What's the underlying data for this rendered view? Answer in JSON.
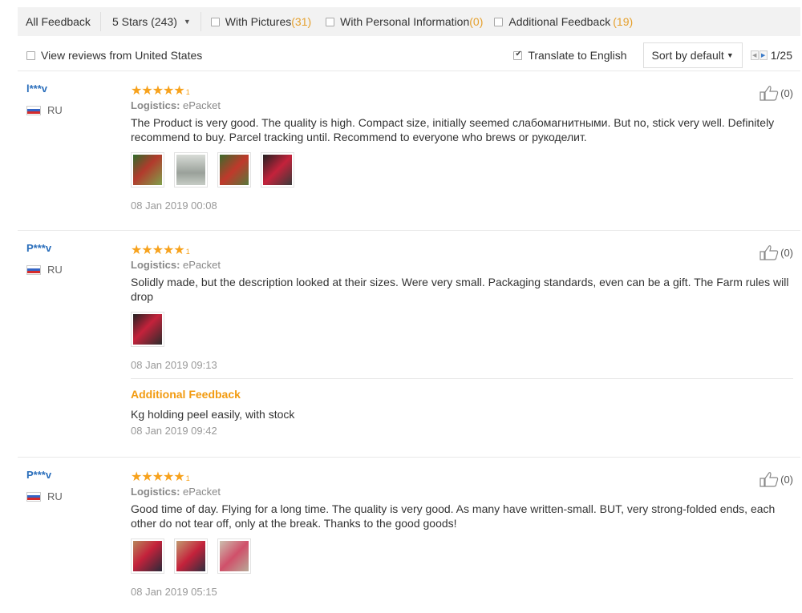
{
  "filters": {
    "all_feedback": "All Feedback",
    "stars_select": "5 Stars (243)",
    "with_pictures_label": "With Pictures",
    "with_pictures_count": "(31)",
    "personal_info_label": "With Personal Information",
    "personal_info_count": "(0)",
    "additional_label": "Additional Feedback",
    "additional_count": "(19)"
  },
  "options": {
    "view_us": "View reviews from United States",
    "translate": "Translate to English",
    "translate_checked": true,
    "sort": "Sort by default",
    "page": "1/25"
  },
  "colors": {
    "accent_orange": "#f7a21d",
    "link_blue": "#2a6ebb",
    "count_orange": "#e5a02d"
  },
  "reviews": [
    {
      "user": "l***v",
      "country": "RU",
      "rating": 5,
      "logistics_label": "Logistics:",
      "logistics_value": "ePacket",
      "text": "The Product is very good. The quality is high. Compact size, initially seemed слабомагнитными. But no, stick very well. Definitely recommend to buy. Parcel tracking until. Recommend to everyone who brews or рукоделит.",
      "images": 4,
      "date": "08 Jan 2019 00:08",
      "helpful": "(0)"
    },
    {
      "user": "P***v",
      "country": "RU",
      "rating": 5,
      "logistics_label": "Logistics:",
      "logistics_value": "ePacket",
      "text": "Solidly made, but the description looked at their sizes. Were very small. Packaging standards, even can be a gift. The Farm rules will drop",
      "images": 1,
      "date": "08 Jan 2019 09:13",
      "helpful": "(0)",
      "additional": {
        "title": "Additional Feedback",
        "text": "Kg holding peel easily, with stock",
        "date": "08 Jan 2019 09:42"
      }
    },
    {
      "user": "P***v",
      "country": "RU",
      "rating": 5,
      "logistics_label": "Logistics:",
      "logistics_value": "ePacket",
      "text": "Good time of day. Flying for a long time. The quality is very good. As many have written-small. BUT, very strong-folded ends, each other do not tear off, only at the break. Thanks to the good goods!",
      "images": 3,
      "date": "08 Jan 2019 05:15",
      "helpful": "(0)"
    }
  ]
}
